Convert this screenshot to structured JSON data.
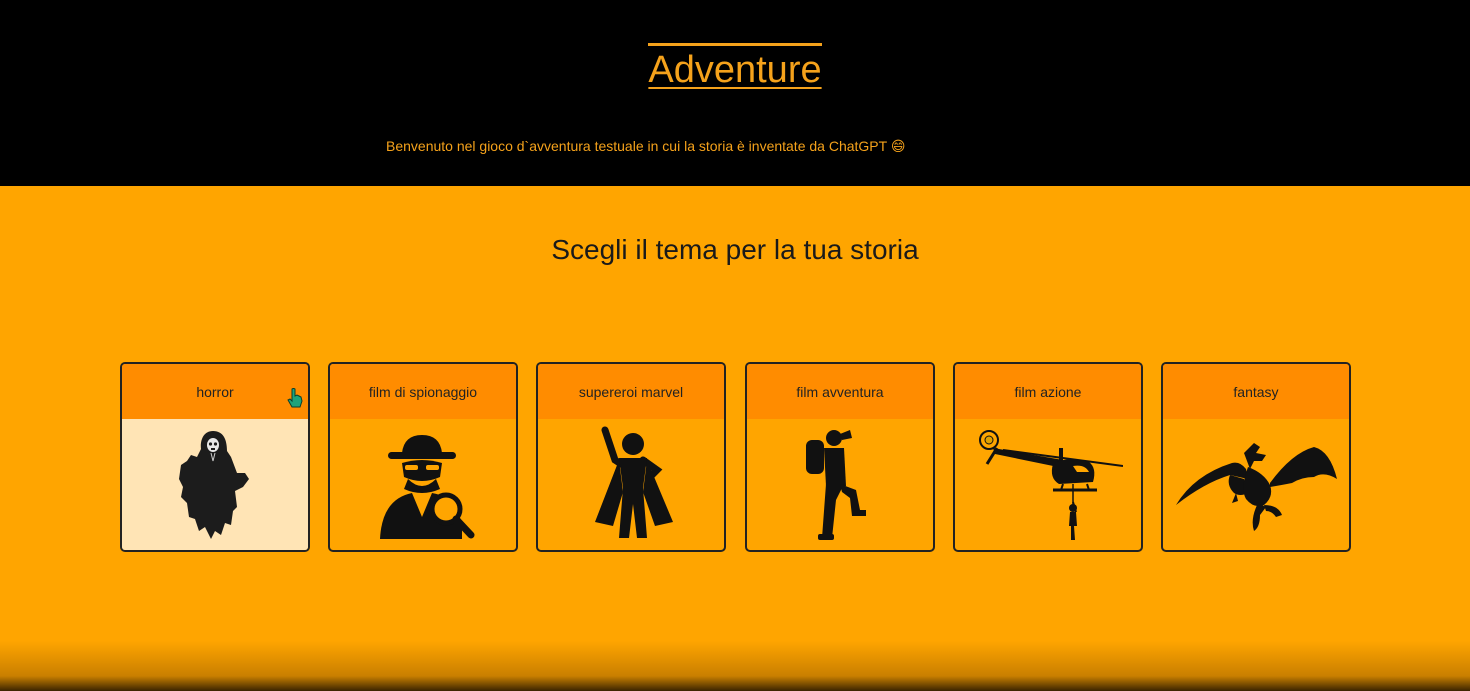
{
  "header": {
    "title": "Adventure",
    "welcome": "Benvenuto nel gioco d`avventura testuale in cui la storia è inventate da ChatGPT 😄"
  },
  "main": {
    "subtitle": "Scegli il tema per la tua storia"
  },
  "themes": [
    {
      "label": "horror",
      "icon": "ghost-icon"
    },
    {
      "label": "film di spionaggio",
      "icon": "spy-icon"
    },
    {
      "label": "supereroi marvel",
      "icon": "superhero-icon"
    },
    {
      "label": "film avventura",
      "icon": "hiker-icon"
    },
    {
      "label": "film azione",
      "icon": "helicopter-icon"
    },
    {
      "label": "fantasy",
      "icon": "dragon-icon"
    }
  ],
  "colors": {
    "header_bg": "#000000",
    "accent": "#f5a21b",
    "page_bg": "#ffa500",
    "card_head": "#ff8c00",
    "card_hover_body": "#ffe4b5"
  }
}
